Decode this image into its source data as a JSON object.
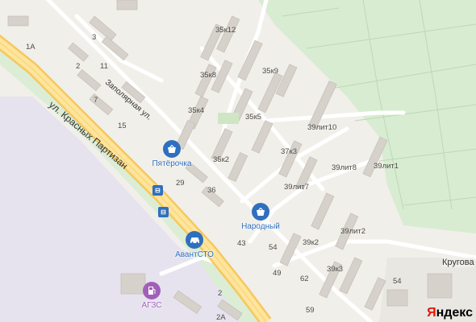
{
  "map": {
    "streets": {
      "krasnykh_partizan": "ул. Красных Партизан",
      "zapolyarnaya": "Заполярная ул.",
      "krugovaya": "Кругова"
    },
    "house_numbers": [
      "1А",
      "3",
      "2",
      "11",
      "7",
      "15",
      "35к12",
      "35к8",
      "35к9",
      "35к4",
      "35к5",
      "39лит10",
      "37к3",
      "35к2",
      "39лит8",
      "39лит1",
      "29",
      "36",
      "39лит7",
      "54",
      "39к2",
      "39лит2",
      "43",
      "39к3",
      "49",
      "62",
      "54",
      "2",
      "59",
      "2А"
    ],
    "pois": [
      {
        "name": "Пятёрочка",
        "icon": "basket-icon",
        "color": "#2f6fbf"
      },
      {
        "name": "Народный",
        "icon": "basket-icon",
        "color": "#2f6fbf"
      },
      {
        "name": "АвантСТО",
        "icon": "car-service-icon",
        "color": "#2f6fbf"
      },
      {
        "name": "АГЗС",
        "icon": "gas-station-icon",
        "color": "#a05fb8"
      }
    ],
    "bus_stop_icon": "bus-stop-icon",
    "logo": {
      "first": "Я",
      "rest": "ндекс"
    }
  }
}
